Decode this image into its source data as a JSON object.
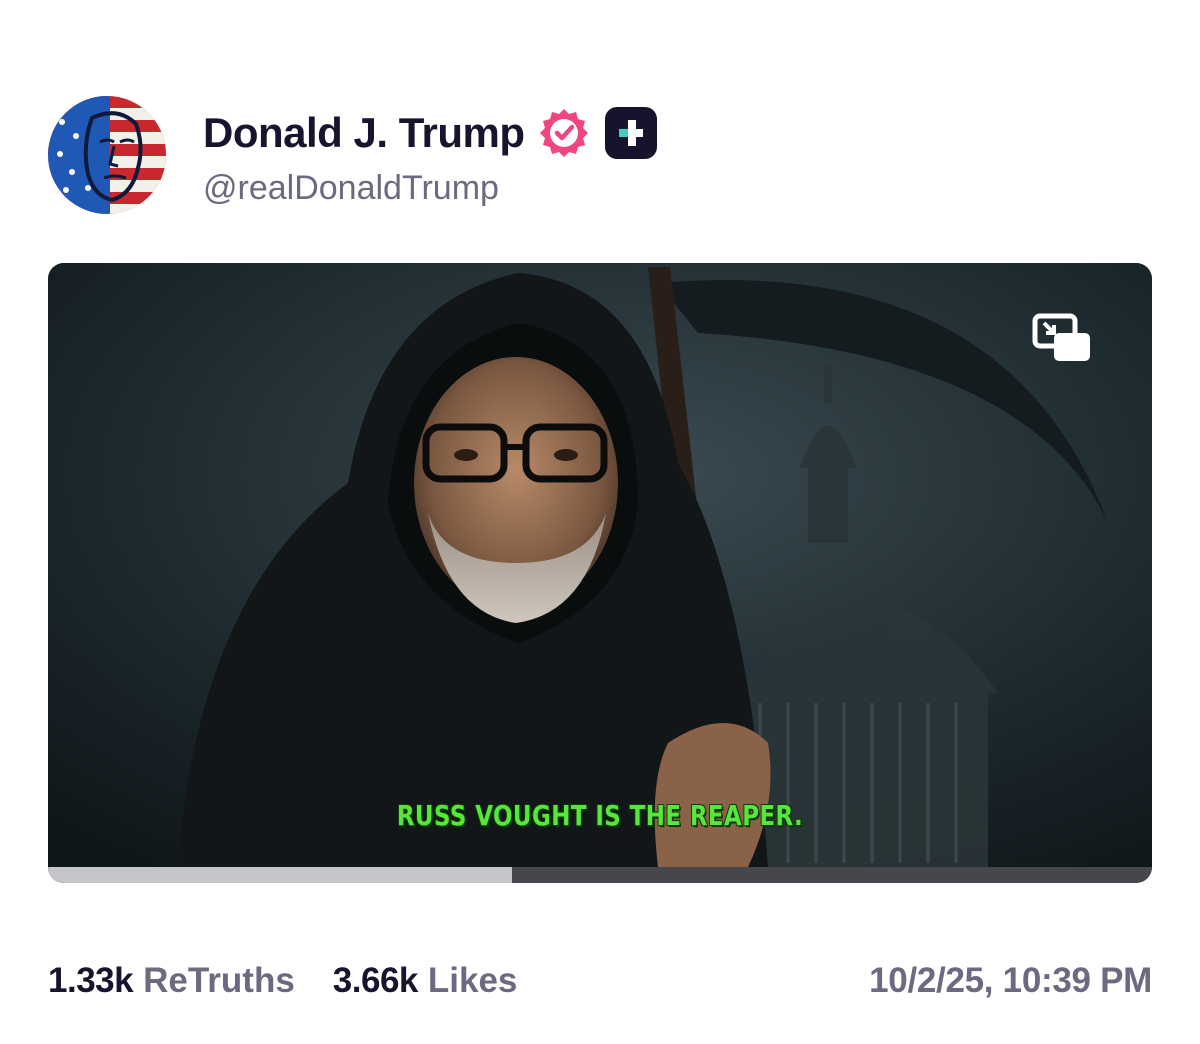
{
  "post": {
    "author": {
      "display_name": "Donald J. Trump",
      "handle": "@realDonaldTrump",
      "verified_badge_color": "#f0457f",
      "plus_badge_color": "#16142c"
    },
    "media": {
      "caption": "RUSS VOUGHT IS THE REAPER.",
      "caption_color": "#58e63d",
      "progress": 0.42,
      "pip_icon": "picture-in-picture-icon"
    },
    "stats": {
      "retruths_count": "1.33k",
      "retruths_label": "ReTruths",
      "likes_count": "3.66k",
      "likes_label": "Likes"
    },
    "timestamp": "10/2/25, 10:39 PM"
  },
  "colors": {
    "primary_text": "#17152e",
    "secondary_text": "#6b6a80",
    "progress_played": "#c4c5c8",
    "progress_remaining": "#46474c"
  }
}
